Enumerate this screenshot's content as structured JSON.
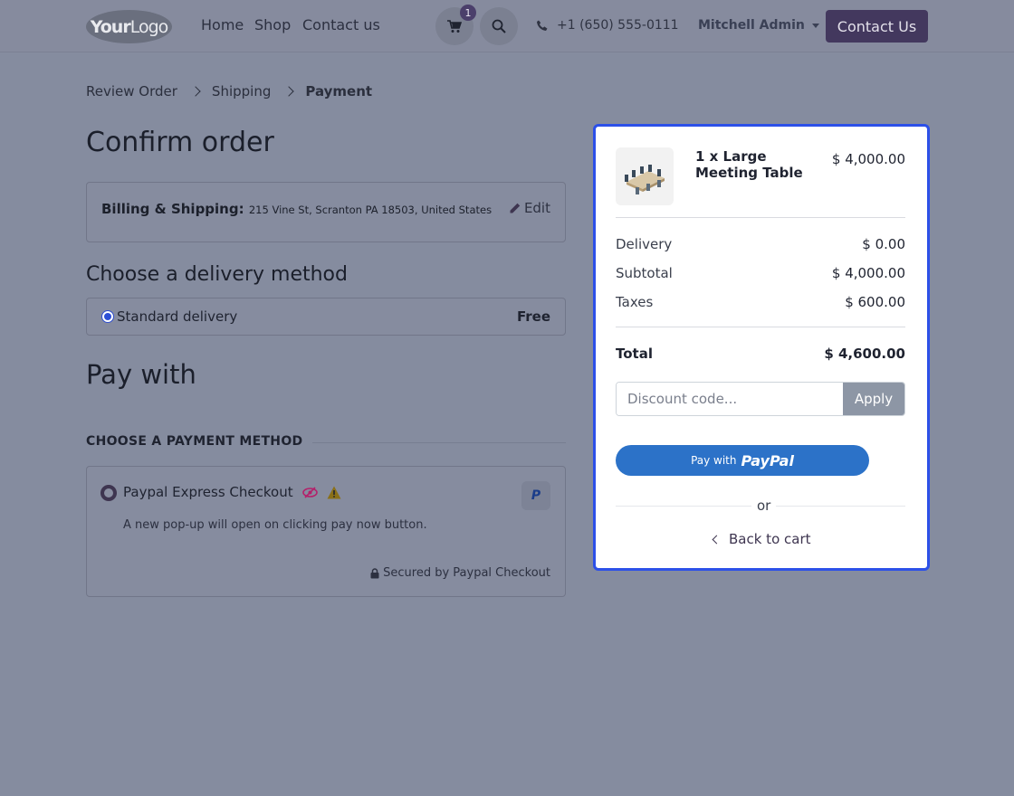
{
  "navbar": {
    "logo_bold": "Your",
    "logo_light": "Logo",
    "links": [
      "Home",
      "Shop",
      "Contact us"
    ],
    "cart_count": "1",
    "phone": "+1 (650) 555-0111",
    "user": "Mitchell Admin",
    "contact_button": "Contact Us"
  },
  "breadcrumb": [
    "Review Order",
    "Shipping",
    "Payment"
  ],
  "page_title": "Confirm order",
  "billing": {
    "label": "Billing & Shipping:",
    "address": "215 Vine St, Scranton PA 18503, United States",
    "edit_label": "Edit"
  },
  "delivery": {
    "heading": "Choose a delivery method",
    "method": "Standard delivery",
    "price": "Free"
  },
  "payment": {
    "heading": "Pay with",
    "subheading": "CHOOSE A PAYMENT METHOD",
    "method_name": "Paypal Express Checkout",
    "description": "A new pop-up will open on clicking pay now button.",
    "secured": "Secured by Paypal Checkout",
    "badge_letter": "P"
  },
  "summary": {
    "product": "1 x Large Meeting Table",
    "product_price": "$ 4,000.00",
    "rows": [
      {
        "label": "Delivery",
        "value": "$ 0.00"
      },
      {
        "label": "Subtotal",
        "value": "$ 4,000.00"
      },
      {
        "label": "Taxes",
        "value": "$ 600.00"
      }
    ],
    "total_label": "Total",
    "total_value": "$ 4,600.00",
    "discount_placeholder": "Discount code...",
    "apply_label": "Apply",
    "paypal_prefix": "Pay with",
    "paypal_word": "PayPal",
    "or_label": "or",
    "back_label": "Back to cart"
  },
  "colors": {
    "accent": "#43385e",
    "highlight_border": "#2c50e8",
    "paypal": "#2c72c8"
  }
}
